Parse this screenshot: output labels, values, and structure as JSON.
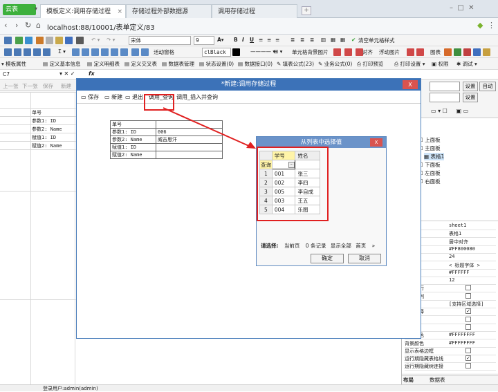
{
  "browser": {
    "app_label": "云表",
    "tabs": [
      {
        "label": "模板定义:调用存储过程"
      },
      {
        "label": "存储过程外部数据源"
      },
      {
        "label": "调用存储过程"
      }
    ],
    "url": "localhost:88/10001/表单定义/83"
  },
  "toolbar1": {
    "font": "宋体",
    "size": "9",
    "clear_label": "清空单元格样式"
  },
  "toolbar2": {
    "activity_window": "活动窗格",
    "color": "clBlack",
    "cell_bg": "单元格背景图片",
    "align": "对齐",
    "float_image": "浮动图片",
    "chart": "图表"
  },
  "toolbar3": {
    "items": [
      "模板属性",
      "定义基本信息",
      "定义明细表",
      "定义交叉表",
      "数据表管理",
      "状态设置(0)",
      "数据接口(0)",
      "填表公式(23)",
      "业务公式(0)",
      "打印预览",
      "打印设置",
      "权限",
      "调试"
    ]
  },
  "formula": {
    "cell_ref": "C7",
    "fx": "fx"
  },
  "rowbar": {
    "items": [
      "上一张",
      "下一张",
      "保存",
      "新建"
    ]
  },
  "grid": {
    "rows": [
      "单号",
      "参数1: ID",
      "参数2: Name",
      "赋值1: ID",
      "赋值2: Name"
    ]
  },
  "right_panel": {
    "settings_label": "设置",
    "auto_label": "自动",
    "tree": {
      "root": "表单",
      "items": [
        "上面板",
        "主面板",
        "表格1",
        "下面板",
        "左面板",
        "右面板"
      ]
    },
    "props": [
      {
        "k": "",
        "v": "sheet1"
      },
      {
        "k": "",
        "v": "表格1"
      },
      {
        "k": "序方式",
        "v": "居中对齐"
      },
      {
        "k": "题颜色",
        "v": "#FF800080"
      },
      {
        "k": "度",
        "v": "24"
      },
      {
        "k": "体",
        "v": "< 标题字体 >"
      },
      {
        "k": "",
        "v": "#FFFFFF"
      },
      {
        "k": "",
        "v": "12"
      },
      {
        "k": "格标题行",
        "v": "check"
      },
      {
        "k": "格标题列",
        "v": "check"
      },
      {
        "k": "员",
        "v": "[支持区域选择]"
      },
      {
        "k": "区域选择",
        "v": "checked"
      },
      {
        "k": "行选",
        "v": "check"
      },
      {
        "k": "",
        "v": "check"
      },
      {
        "k": "表格颜色",
        "v": "#FFFFFFFF"
      },
      {
        "k": "背景颜色",
        "v": "#FFFFFFFF"
      },
      {
        "k": "显示表格边框",
        "v": "check"
      },
      {
        "k": "运行期隐藏表格线",
        "v": "checked"
      },
      {
        "k": "运行期隐藏树连接",
        "v": "check"
      }
    ],
    "tabs": [
      "布局",
      "数据表"
    ]
  },
  "status": {
    "user": "登录用户:admin(admin)"
  },
  "dialog": {
    "title": "*新建:调用存储过程",
    "close": "X",
    "buttons": [
      "保存",
      "新建",
      "退出",
      "调用_查询",
      "调用_插入并查询"
    ],
    "form": [
      {
        "label": "单号",
        "value": ""
      },
      {
        "label": "参数1: ID",
        "value": "006"
      },
      {
        "label": "参数2: Name",
        "value": "威吉思汗"
      },
      {
        "label": "赋值1: ID",
        "value": ""
      },
      {
        "label": "赋值2: Name",
        "value": ""
      }
    ]
  },
  "selector": {
    "title": "从列表中选择值",
    "close": "X",
    "headers": [
      "学号",
      "姓名"
    ],
    "query_label": "查询",
    "query_btn": "···",
    "rows": [
      {
        "n": "1",
        "id": "001",
        "name": "张三"
      },
      {
        "n": "2",
        "id": "002",
        "name": "李四"
      },
      {
        "n": "3",
        "id": "005",
        "name": "李自成"
      },
      {
        "n": "4",
        "id": "003",
        "name": "王五"
      },
      {
        "n": "5",
        "id": "004",
        "name": "乐图"
      }
    ],
    "footer": {
      "label": "请选择:",
      "current": "当前页",
      "count": "0",
      "records": "条记录",
      "show_all": "显示全部",
      "first": "首页",
      "more": "»"
    },
    "ok": "确定",
    "cancel": "取消"
  },
  "colors": {
    "accent": "#3c72b8",
    "highlight": "#e02020",
    "header_yellow": "#fff4a8"
  }
}
